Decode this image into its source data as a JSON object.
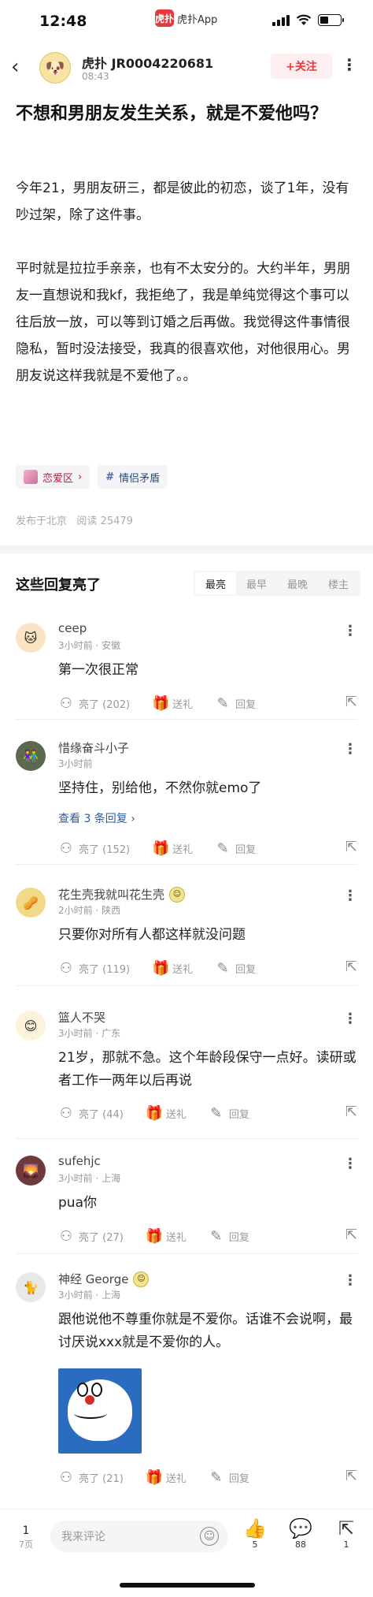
{
  "status": {
    "time": "12:48",
    "app_name": "虎扑App",
    "app_logo_text": "虎扑"
  },
  "nav": {
    "author_name": "虎扑 JR0004220681",
    "post_time": "08:43",
    "follow_label": "+关注"
  },
  "post": {
    "title": "不想和男朋友发生关系，就是不爱他吗？",
    "paragraphs": [
      "今年21，男朋友研三，都是彼此的初恋，谈了1年，没有吵过架，除了这件事。",
      "平时就是拉拉手亲亲，也有不太安分的。大约半年，男朋友一直想说和我kf，我拒绝了，我是单纯觉得这个事可以往后放一放，可以等到订婚之后再做。我觉得这件事情很隐私，暂时没法接受，我真的很喜欢他，对他很用心。男朋友说这样我就是不爱他了。。"
    ],
    "tags": [
      {
        "label": "恋爱区",
        "arrow": "›"
      },
      {
        "label": "情侣矛盾",
        "prefix": "#"
      }
    ],
    "location": "发布于北京",
    "views": "阅读 25479"
  },
  "replies": {
    "title": "这些回复亮了",
    "sort_tabs": [
      "最亮",
      "最早",
      "最晚",
      "楼主"
    ],
    "active_tab": 0
  },
  "comments": [
    {
      "name": "ceep",
      "time": "3小时前 · 安徽",
      "text": "第一次很正常",
      "likes": "亮了 (202)",
      "gift": "送礼",
      "reply": "回复"
    },
    {
      "name": "惜缘奋斗小子",
      "time": "3小时前",
      "text": "坚持住，别给他，不然你就emo了",
      "view_replies": "查看 3 条回复 ›",
      "likes": "亮了 (152)",
      "gift": "送礼",
      "reply": "回复"
    },
    {
      "name": "花生壳我就叫花生壳",
      "time": "2小时前 · 陕西",
      "text": "只要你对所有人都这样就没问题",
      "likes": "亮了 (119)",
      "gift": "送礼",
      "reply": "回复"
    },
    {
      "name": "篮人不哭",
      "time": "3小时前 · 广东",
      "text": "21岁，那就不急。这个年龄段保守一点好。读研或者工作一两年以后再说",
      "likes": "亮了 (44)",
      "gift": "送礼",
      "reply": "回复"
    },
    {
      "name": "sufehjc",
      "time": "3小时前 · 上海",
      "text": "pua你",
      "likes": "亮了 (27)",
      "gift": "送礼",
      "reply": "回复"
    },
    {
      "name": "神经 George",
      "time": "3小时前 · 上海",
      "text": "跟他说他不尊重你就是不爱你。话谁不会说啊，最讨厌说xxx就是不爱你的人。",
      "likes": "亮了 (21)",
      "gift": "送礼",
      "reply": "回复"
    }
  ],
  "bottom_bar": {
    "page": "1",
    "page_total": "7页",
    "comment_placeholder": "我来评论",
    "likes_count": "5",
    "comments_count": "88",
    "shares_count": "1"
  },
  "colors": {
    "brand_red": "#e8383b",
    "link_blue": "#2a5ba8"
  },
  "icons": [
    "back-icon",
    "more-icon",
    "light-icon",
    "gift-icon",
    "reply-icon",
    "share-icon",
    "emoji-icon",
    "like-icon",
    "comment-icon"
  ]
}
